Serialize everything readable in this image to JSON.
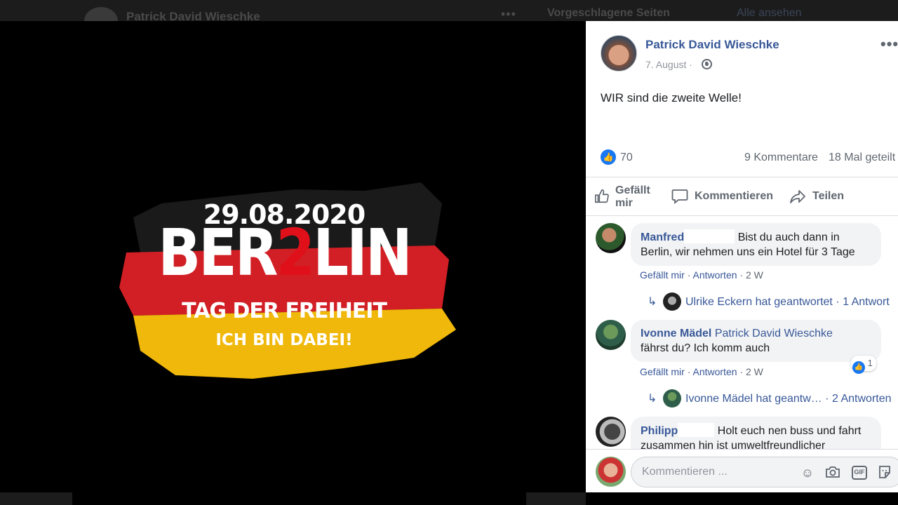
{
  "background": {
    "author": "Patrick David Wieschke",
    "more": "•••",
    "suggested_pages": "Vorgeschlagene Seiten",
    "see_all": "Alle ansehen"
  },
  "poster": {
    "date": "29.08.2020",
    "title_a": "BER",
    "title_b": "2",
    "title_c": "LIN",
    "tagline": "TAG DER FREIHEIT",
    "subline": "ICH BIN DABEI!",
    "flag_colors": [
      "#1a1a1a",
      "#d11f25",
      "#f0b80a"
    ]
  },
  "post": {
    "author": "Patrick David Wieschke",
    "date": "7. August",
    "date_sep": "·",
    "more": "•••",
    "text": "WIR sind die zweite Welle!",
    "likes": "70",
    "comments": "9 Kommentare",
    "shares": "18 Mal geteilt"
  },
  "actions": {
    "like": "Gefällt mir",
    "comment": "Kommentieren",
    "share": "Teilen"
  },
  "comments": [
    {
      "name": "Manfred",
      "text": "Bist du auch dann in Berlin, wir nehmen uns ein Hotel für 3 Tage",
      "like": "Gefällt mir",
      "reply": "Antworten",
      "sep": "·",
      "age": "2 W",
      "reply_summary": "Ulrike Eckern hat geantwortet",
      "reply_count": "· 1 Antwort"
    },
    {
      "name": "Ivonne Mädel",
      "tag": "Patrick David Wieschke",
      "text": "fährst du? Ich komm auch",
      "like": "Gefällt mir",
      "reply": "Antworten",
      "sep": "·",
      "age": "2 W",
      "reactions": "1",
      "reply_summary": "Ivonne Mädel hat geantw…",
      "reply_count": "· 2 Antworten"
    },
    {
      "name": "Philipp",
      "text": "Holt euch nen buss und fahrt zusammen hin ist umweltfreundlicher"
    }
  ],
  "composer": {
    "placeholder": "Kommentieren ..."
  },
  "colors": {
    "link": "#385898",
    "accent": "#1877f2"
  }
}
